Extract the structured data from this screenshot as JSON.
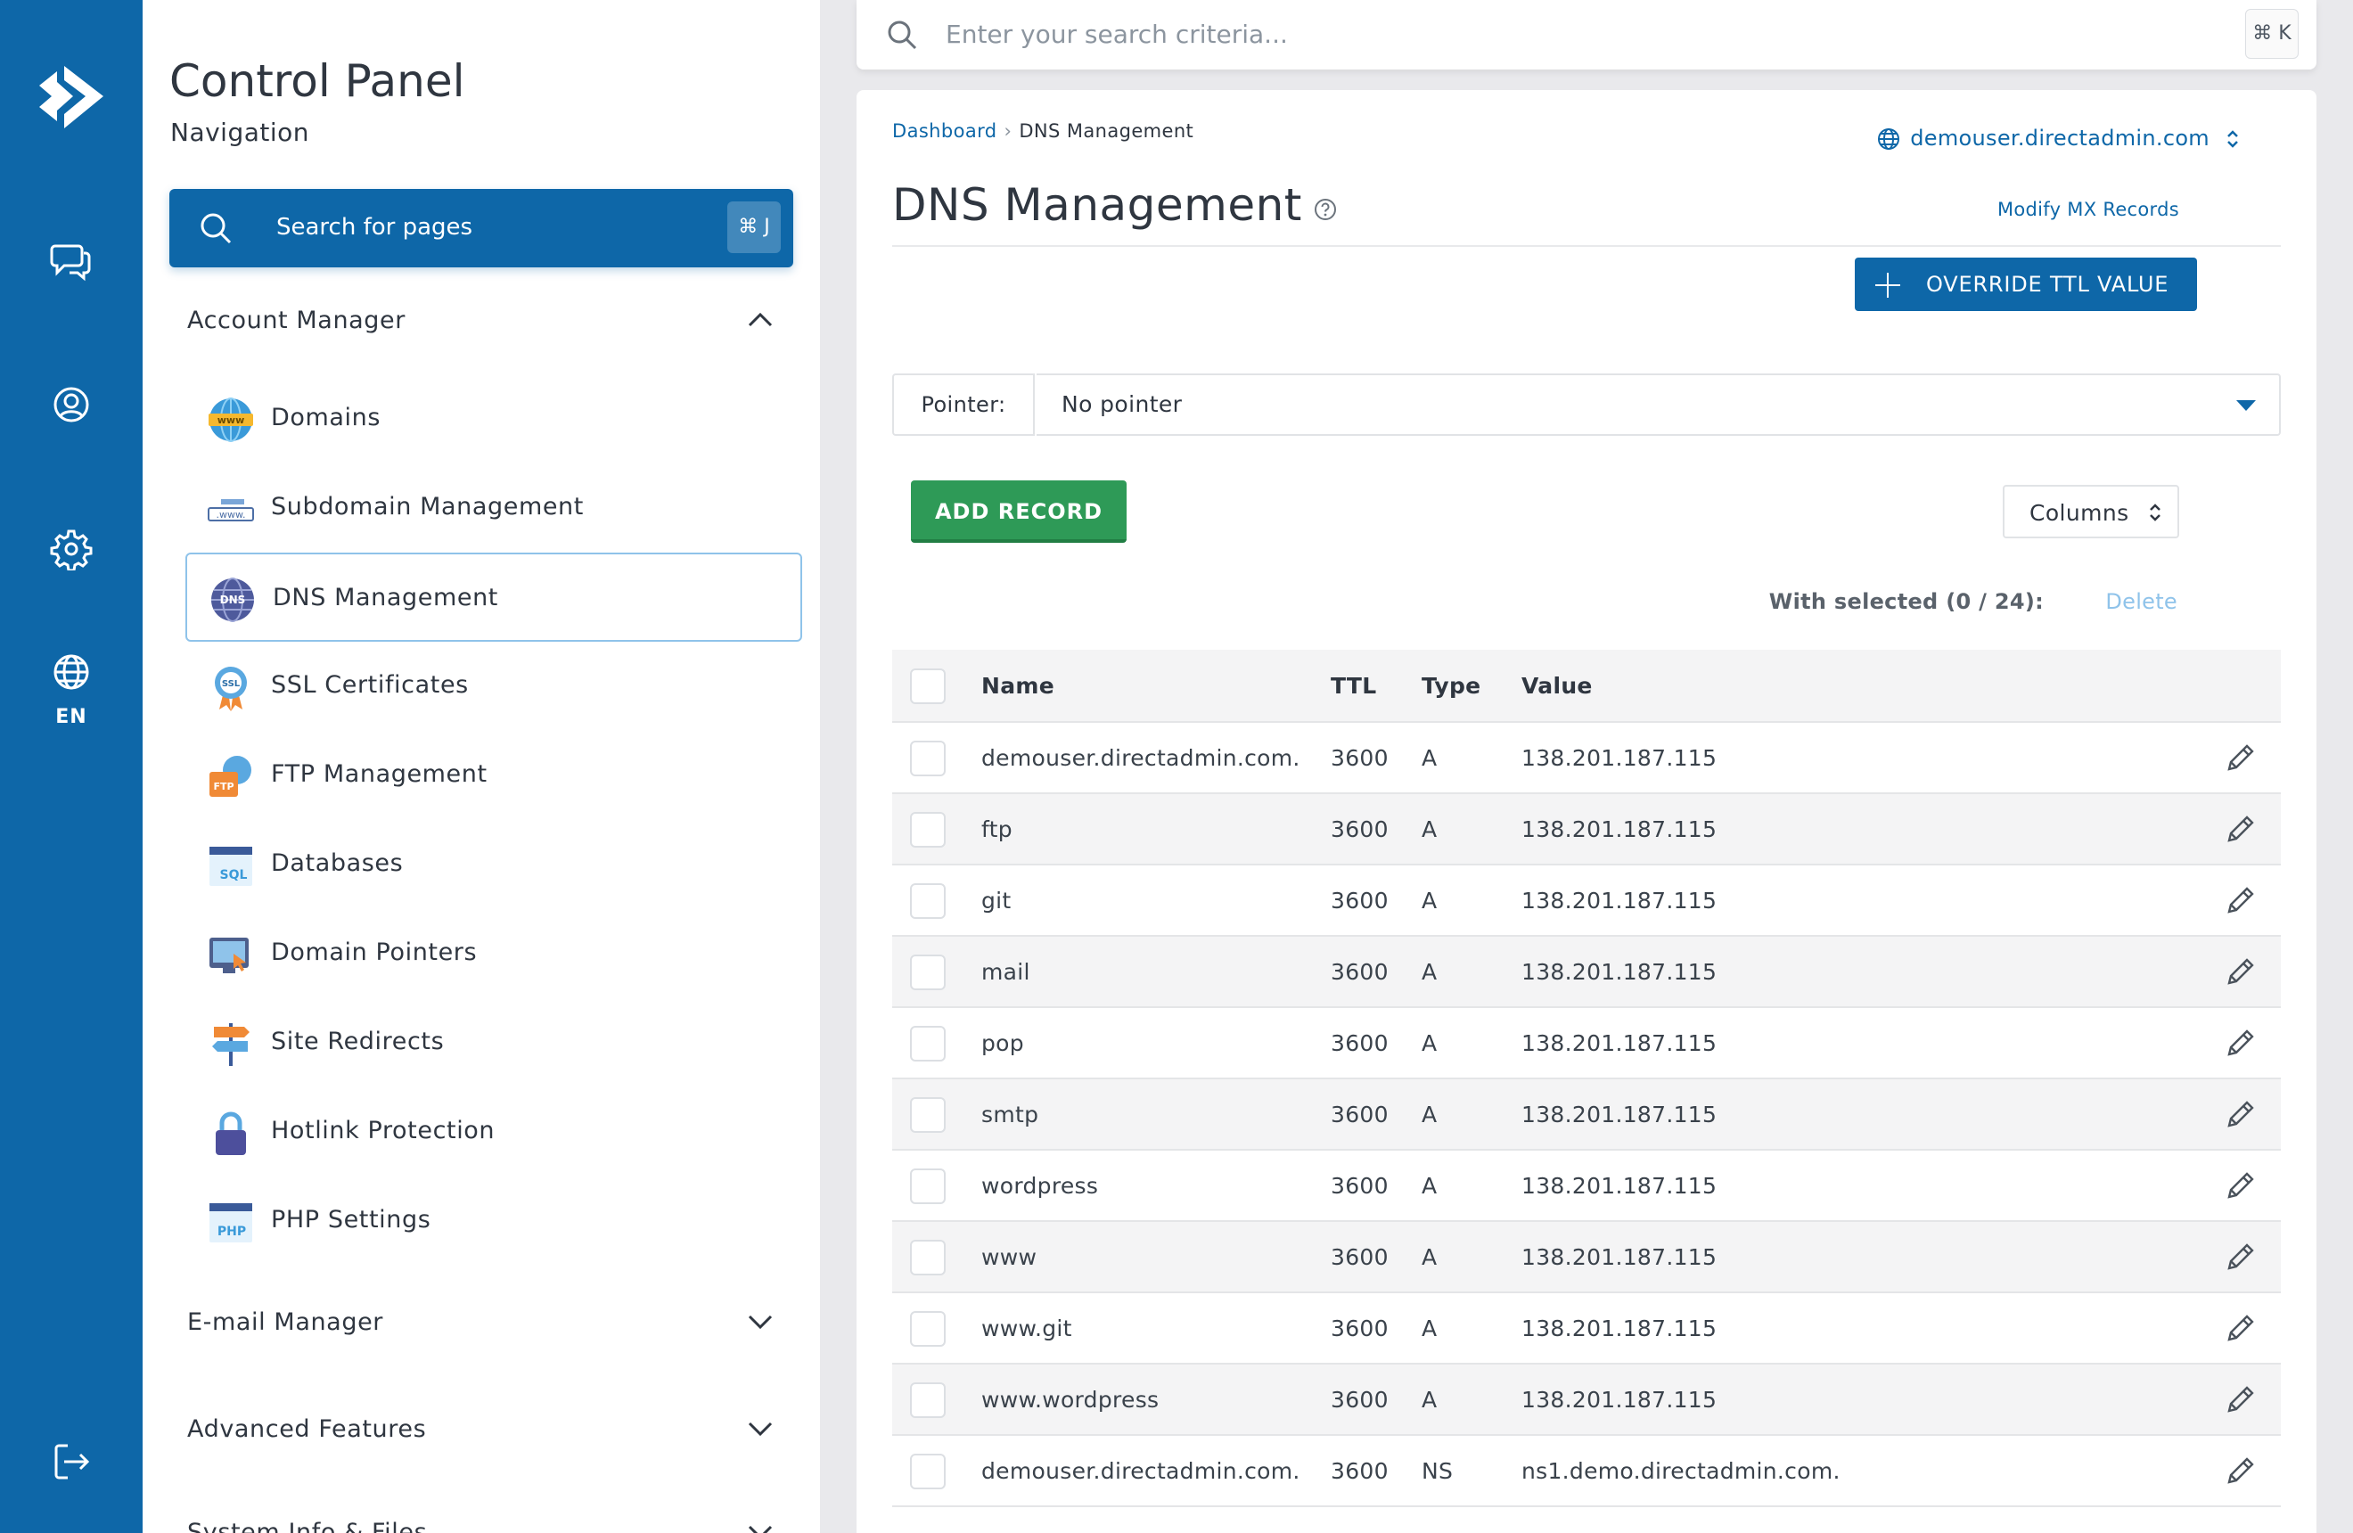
{
  "rail": {
    "lang": "EN"
  },
  "sidebar": {
    "title": "Control Panel",
    "subtitle": "Navigation",
    "search": {
      "placeholder": "Search for pages",
      "shortcut": "⌘ J"
    },
    "sections": {
      "account": "Account Manager",
      "email": "E-mail Manager",
      "advanced": "Advanced Features",
      "system": "System Info & Files"
    },
    "items": [
      {
        "label": "Domains",
        "icon": "domains-icon"
      },
      {
        "label": "Subdomain Management",
        "icon": "subdomain-icon"
      },
      {
        "label": "DNS Management",
        "icon": "dns-icon",
        "active": true
      },
      {
        "label": "SSL Certificates",
        "icon": "ssl-icon"
      },
      {
        "label": "FTP Management",
        "icon": "ftp-icon"
      },
      {
        "label": "Databases",
        "icon": "databases-icon"
      },
      {
        "label": "Domain Pointers",
        "icon": "domain-pointers-icon"
      },
      {
        "label": "Site Redirects",
        "icon": "site-redirects-icon"
      },
      {
        "label": "Hotlink Protection",
        "icon": "lock-icon"
      },
      {
        "label": "PHP Settings",
        "icon": "php-icon"
      }
    ],
    "icon_text": {
      "domains": "www",
      "subdomain": ".www.",
      "dns": "DNS",
      "ssl": "SSL",
      "ftp": "FTP",
      "sql": "SQL",
      "php": "PHP"
    }
  },
  "topsearch": {
    "placeholder": "Enter your search criteria...",
    "shortcut": "⌘ K"
  },
  "main": {
    "breadcrumb": {
      "home": "Dashboard",
      "sep": "›",
      "current": "DNS Management"
    },
    "domain": "demouser.directadmin.com",
    "title": "DNS Management",
    "mx_link": "Modify MX Records",
    "override_btn": "OVERRIDE TTL VALUE",
    "pointer_label": "Pointer:",
    "pointer_value": "No pointer",
    "add_btn": "ADD RECORD",
    "columns_btn": "Columns",
    "with_selected": "With selected (0 / 24):",
    "delete": "Delete",
    "table": {
      "headers": {
        "name": "Name",
        "ttl": "TTL",
        "type": "Type",
        "value": "Value"
      },
      "rows": [
        {
          "name": "demouser.directadmin.com.",
          "ttl": "3600",
          "type": "A",
          "value": "138.201.187.115"
        },
        {
          "name": "ftp",
          "ttl": "3600",
          "type": "A",
          "value": "138.201.187.115"
        },
        {
          "name": "git",
          "ttl": "3600",
          "type": "A",
          "value": "138.201.187.115"
        },
        {
          "name": "mail",
          "ttl": "3600",
          "type": "A",
          "value": "138.201.187.115"
        },
        {
          "name": "pop",
          "ttl": "3600",
          "type": "A",
          "value": "138.201.187.115"
        },
        {
          "name": "smtp",
          "ttl": "3600",
          "type": "A",
          "value": "138.201.187.115"
        },
        {
          "name": "wordpress",
          "ttl": "3600",
          "type": "A",
          "value": "138.201.187.115"
        },
        {
          "name": "www",
          "ttl": "3600",
          "type": "A",
          "value": "138.201.187.115"
        },
        {
          "name": "www.git",
          "ttl": "3600",
          "type": "A",
          "value": "138.201.187.115"
        },
        {
          "name": "www.wordpress",
          "ttl": "3600",
          "type": "A",
          "value": "138.201.187.115"
        },
        {
          "name": "demouser.directadmin.com.",
          "ttl": "3600",
          "type": "NS",
          "value": "ns1.demo.directadmin.com."
        }
      ]
    }
  },
  "colors": {
    "brand": "#0e67a8",
    "success": "#2e9a57",
    "muted_link": "#8fc3ea"
  }
}
